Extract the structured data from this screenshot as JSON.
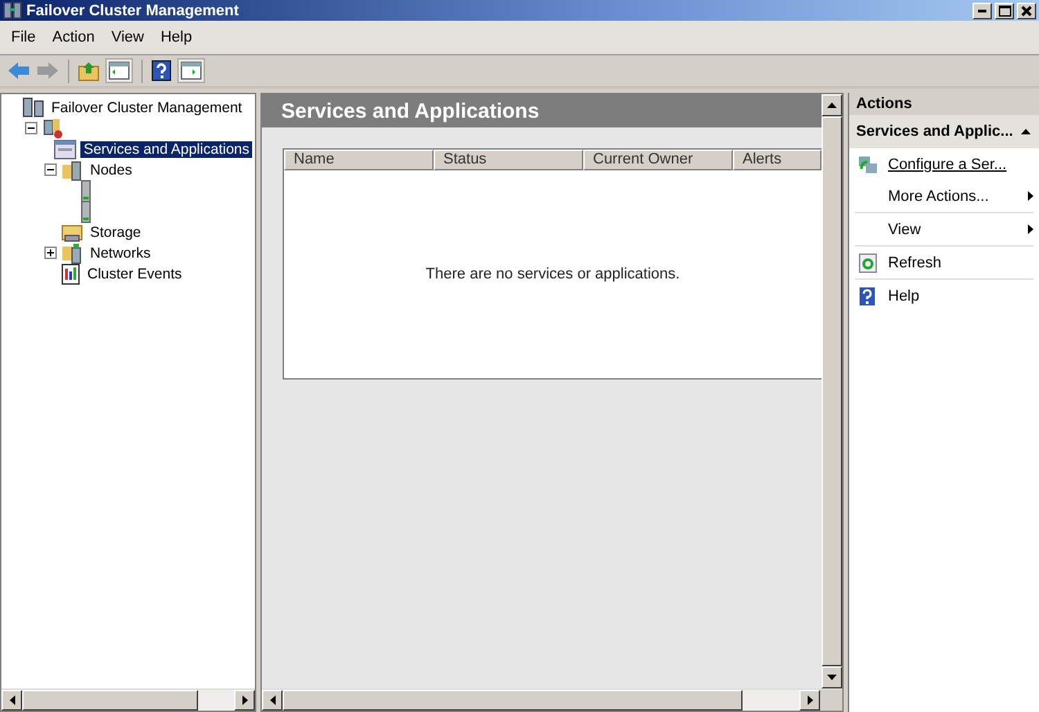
{
  "window": {
    "title": "Failover Cluster Management"
  },
  "menu": [
    "File",
    "Action",
    "View",
    "Help"
  ],
  "tree": [
    {
      "label": "Failover Cluster Management",
      "kind": "root",
      "selected": false,
      "children": [
        {
          "kind": "cluster",
          "expanded": true,
          "children": [
            {
              "label": "Services and Applications",
              "kind": "services",
              "selected": true
            },
            {
              "label": "Nodes",
              "kind": "nodes",
              "selected": false,
              "expanded": true,
              "children": [
                {
                  "kind": "server"
                },
                {
                  "kind": "server"
                }
              ]
            },
            {
              "label": "Storage",
              "kind": "storage",
              "selected": false
            },
            {
              "label": "Networks",
              "kind": "networks",
              "selected": false,
              "expanded": false
            },
            {
              "label": "Cluster Events",
              "kind": "events",
              "selected": false
            }
          ]
        }
      ]
    }
  ],
  "content": {
    "title": "Services and Applications",
    "columns": [
      "Name",
      "Status",
      "Current Owner",
      "Alerts"
    ],
    "empty_message": "There are no services or applications."
  },
  "actions": {
    "title": "Actions",
    "section": "Services and Applic...",
    "items": [
      {
        "label": "Configure a Ser...",
        "kind": "link"
      },
      {
        "label": "More Actions...",
        "kind": "submenu"
      },
      {
        "label": "View",
        "kind": "submenu"
      },
      {
        "label": "Refresh",
        "kind": "refresh"
      },
      {
        "label": "Help",
        "kind": "help"
      }
    ]
  }
}
